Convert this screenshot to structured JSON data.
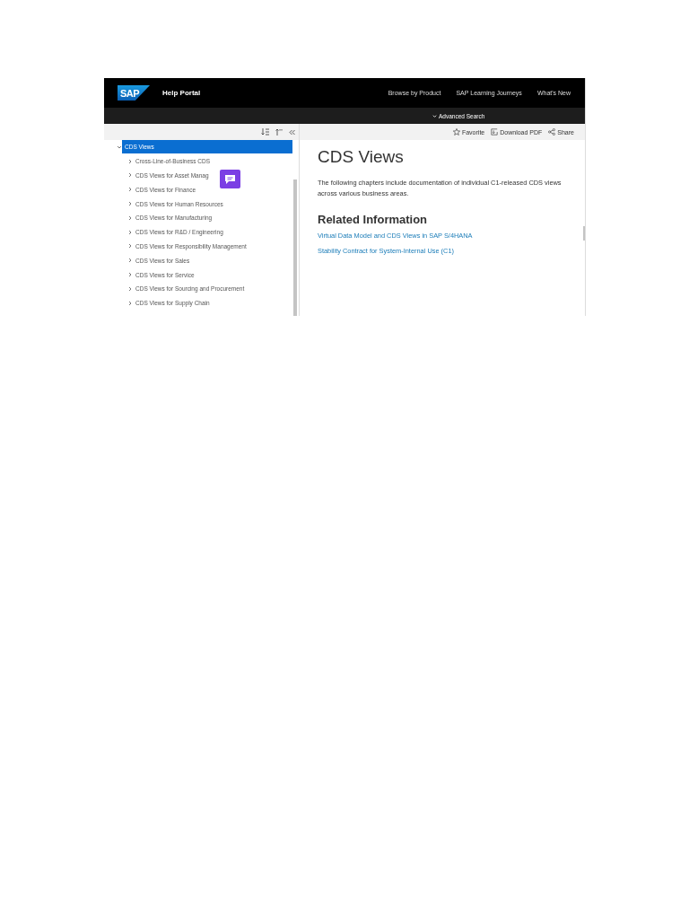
{
  "header": {
    "logo_text": "SAP",
    "title": "Help Portal",
    "nav": [
      "Browse by Product",
      "SAP Learning Journeys",
      "What's New"
    ]
  },
  "subbar": {
    "advanced_search": "Advanced Search"
  },
  "toolbar": {
    "actions": [
      "Favorite",
      "Download PDF",
      "Share"
    ]
  },
  "tree": {
    "root": {
      "label": "CDS Views",
      "selected": true,
      "expanded": true,
      "children": [
        {
          "label": "Cross-Line-of-Business CDS",
          "selected": false,
          "expanded": false
        },
        {
          "label": "CDS Views for Asset Manag",
          "selected": false,
          "expanded": false
        },
        {
          "label": "CDS Views for Finance",
          "selected": false,
          "expanded": false
        },
        {
          "label": "CDS Views for Human Resources",
          "selected": false,
          "expanded": false
        },
        {
          "label": "CDS Views for Manufacturing",
          "selected": false,
          "expanded": false
        },
        {
          "label": "CDS Views for R&D / Engineering",
          "selected": false,
          "expanded": false
        },
        {
          "label": "CDS Views for Responsibility Management",
          "selected": false,
          "expanded": false
        },
        {
          "label": "CDS Views for Sales",
          "selected": false,
          "expanded": false
        },
        {
          "label": "CDS Views for Service",
          "selected": false,
          "expanded": false
        },
        {
          "label": "CDS Views for Sourcing and Procurement",
          "selected": false,
          "expanded": false
        },
        {
          "label": "CDS Views for Supply Chain",
          "selected": false,
          "expanded": false
        }
      ]
    }
  },
  "content": {
    "title": "CDS Views",
    "body": "The following chapters include documentation of individual C1-released CDS views across various business areas.",
    "related_heading": "Related Information",
    "links": [
      "Virtual Data Model and CDS Views in SAP S/4HANA",
      "Stability Contract for System-Internal Use (C1)"
    ]
  }
}
